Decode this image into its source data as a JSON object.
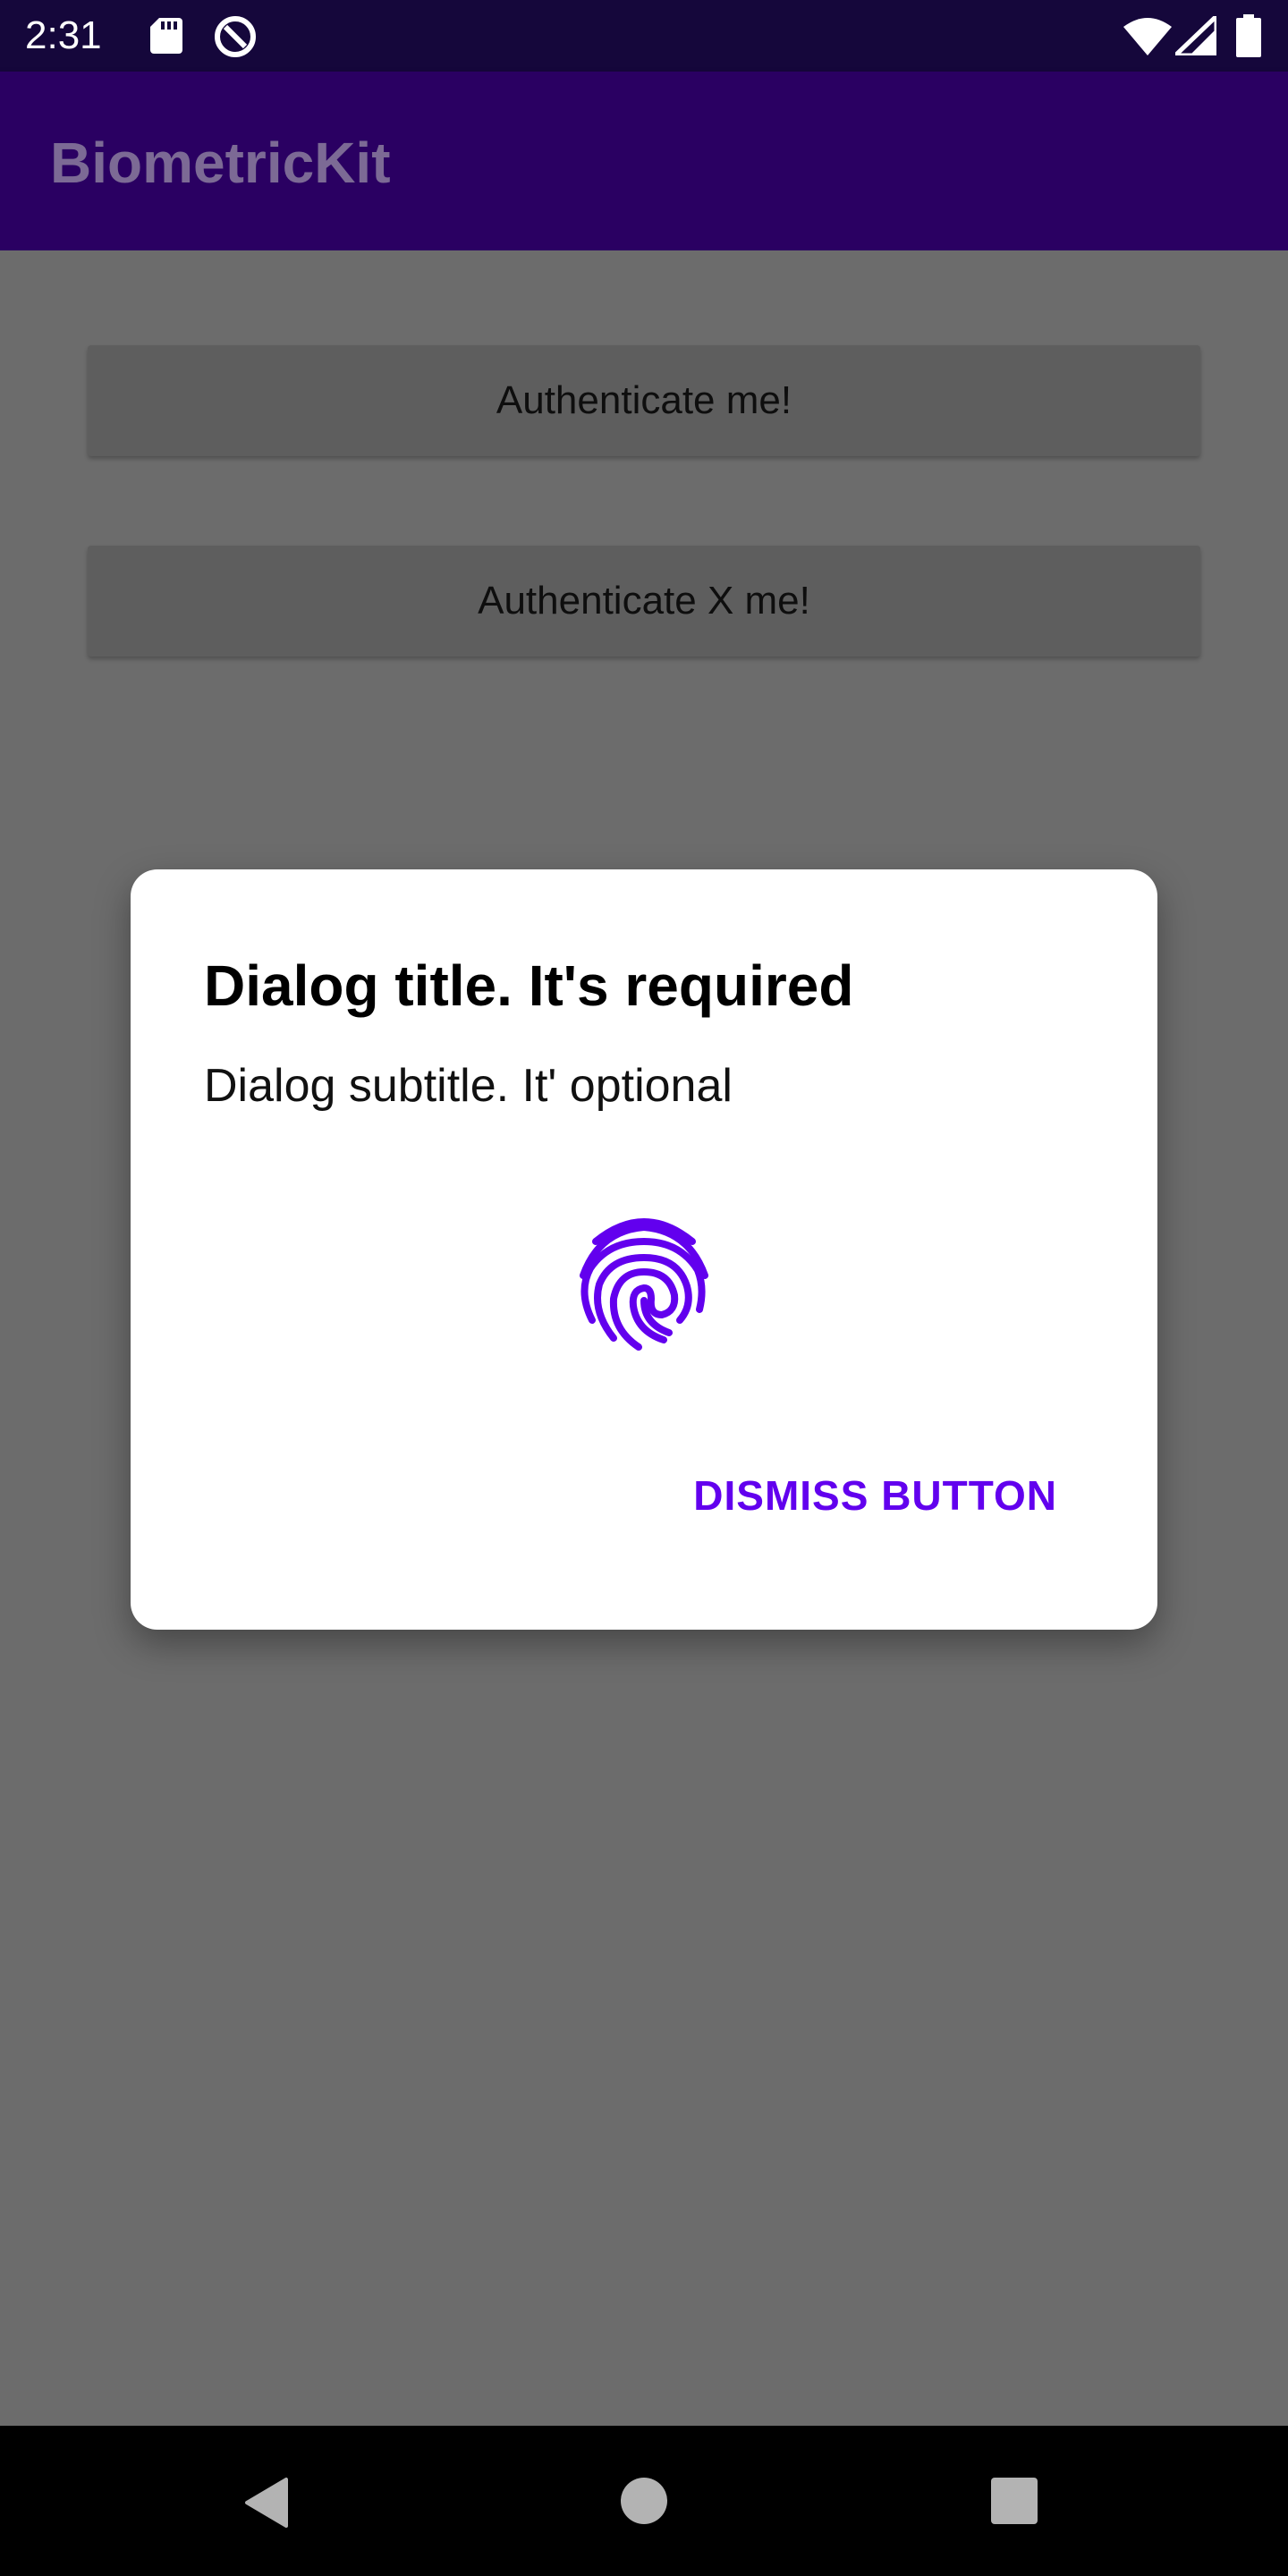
{
  "status_bar": {
    "time": "2:31",
    "icons": [
      "sd-card-icon",
      "data-saver-icon",
      "wifi-icon",
      "signal-icon",
      "battery-icon"
    ]
  },
  "app_bar": {
    "title": "BiometricKit"
  },
  "main": {
    "buttons": [
      {
        "label": "Authenticate me!"
      },
      {
        "label": "Authenticate X me!"
      }
    ]
  },
  "dialog": {
    "title": "Dialog title. It's required",
    "subtitle": "Dialog subtitle. It' optional",
    "icon": "fingerprint-icon",
    "dismiss_label": "DISMISS BUTTON"
  },
  "nav_bar": {
    "icons": [
      "back-icon",
      "home-icon",
      "recents-icon"
    ]
  },
  "colors": {
    "status_bar": "#15073b",
    "app_bar": "#2a0062",
    "scrim_background": "#6c6c6c",
    "accent": "#6200ee",
    "nav_bar": "#000000"
  }
}
